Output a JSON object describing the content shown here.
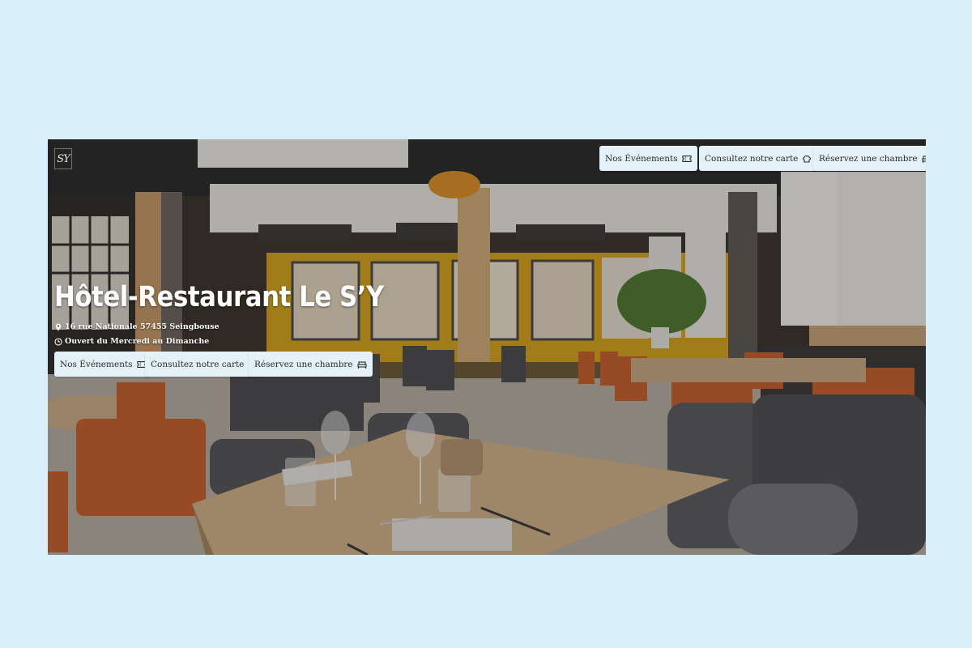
{
  "logo": {
    "text": "SY"
  },
  "hero": {
    "title": "Hôtel-Restaurant Le S’Y",
    "address": "16 rue Nationale 57455 Seingbouse",
    "hours": "Ouvert du Mercredi au Dimanche"
  },
  "topnav": {
    "events": "Nos Événements",
    "menu": "Consultez notre carte",
    "room": "Réservez une chambre"
  },
  "actions": {
    "events": "Nos Événements",
    "menu": "Consultez notre carte",
    "room": "Réservez une chambre"
  },
  "icons": {
    "events": "ticket-icon",
    "menu": "chef-hat-icon",
    "room": "bed-icon",
    "address": "map-pin-icon",
    "hours": "clock-icon"
  },
  "colors": {
    "page_bg": "#d8eef9",
    "button_bg": "#e4f1f8",
    "wall_yellow": "#d9a51c",
    "chair_orange": "#c8622f",
    "table_wood": "#cfae86"
  }
}
